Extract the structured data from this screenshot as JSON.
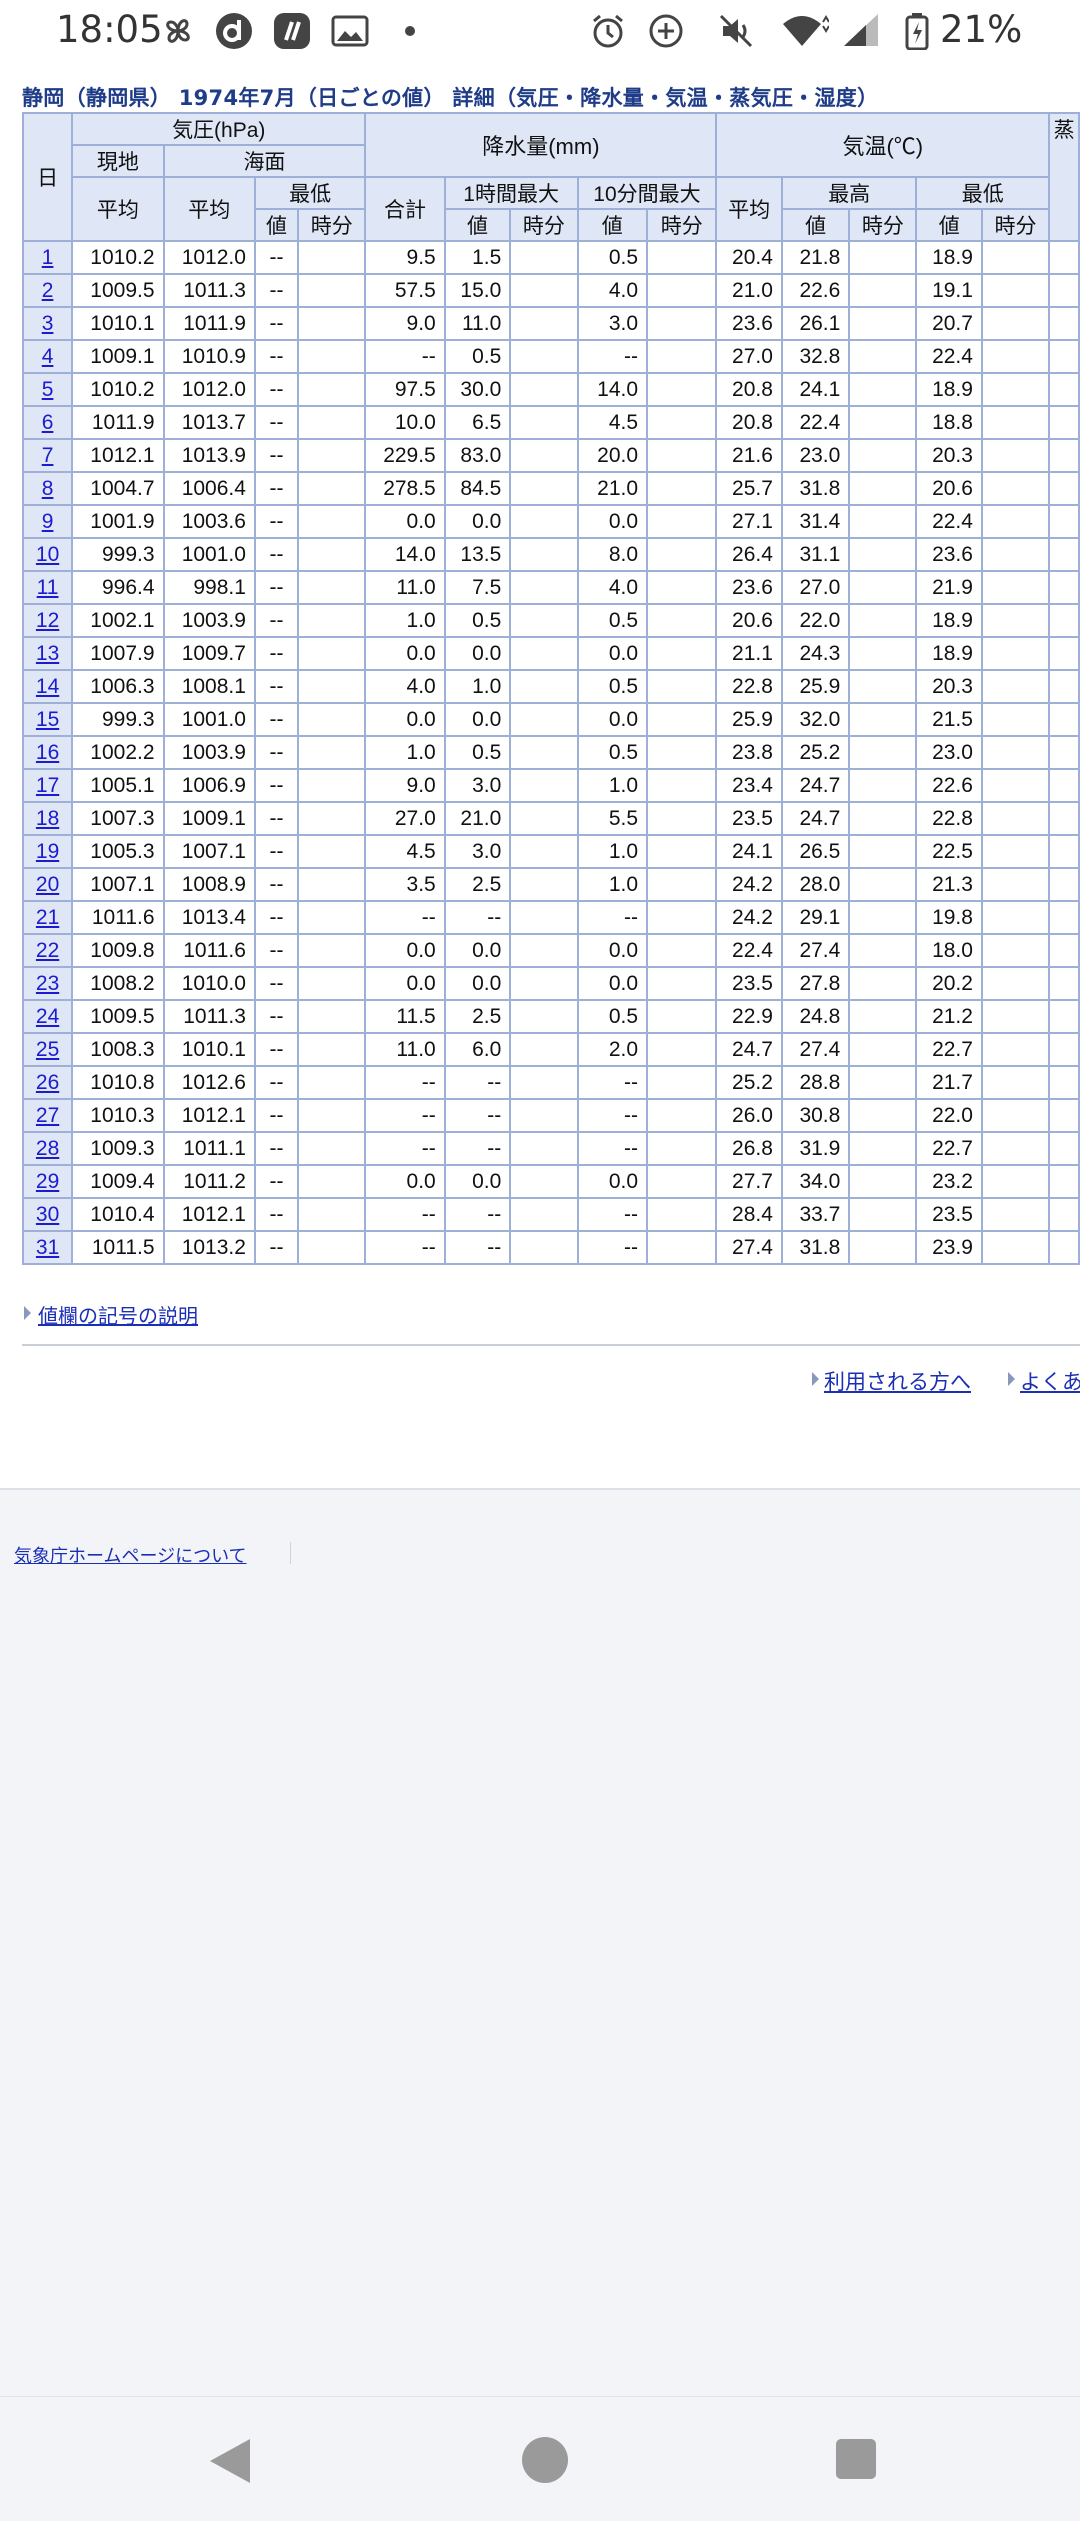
{
  "status_bar": {
    "time": "18:05",
    "battery": "21%",
    "icons": [
      "pinwheel-icon",
      "d-app-icon",
      "slash-app-icon",
      "gallery-icon",
      "dot-icon",
      "alarm-icon",
      "data-saver-icon",
      "mute-icon",
      "wifi-icon",
      "signal-icon",
      "battery-icon"
    ]
  },
  "page": {
    "title": "静岡（静岡県） 1974年7月（日ごとの値） 詳細（気圧・降水量・気温・蒸気圧・湿度）",
    "headers": {
      "day": "日",
      "pressure": "気圧(hPa)",
      "station": "現地",
      "sea": "海面",
      "avg": "平均",
      "min": "最低",
      "value": "値",
      "time": "時分",
      "precip": "降水量(mm)",
      "total": "合計",
      "max1h": "1時間最大",
      "max10m": "10分間最大",
      "temp": "気温(℃)",
      "max": "最高",
      "cut": "蒸"
    },
    "rows": [
      {
        "day": "1",
        "p_avg": "1010.2",
        "s_avg": "1012.0",
        "s_min": "--",
        "s_min_t": "",
        "total": "9.5",
        "h1": "1.5",
        "h1_t": "",
        "m10": "0.5",
        "m10_t": "",
        "t_avg": "20.4",
        "t_max": "21.8",
        "t_max_t": "",
        "t_min": "18.9",
        "t_min_t": ""
      },
      {
        "day": "2",
        "p_avg": "1009.5",
        "s_avg": "1011.3",
        "s_min": "--",
        "s_min_t": "",
        "total": "57.5",
        "h1": "15.0",
        "h1_t": "",
        "m10": "4.0",
        "m10_t": "",
        "t_avg": "21.0",
        "t_max": "22.6",
        "t_max_t": "",
        "t_min": "19.1",
        "t_min_t": ""
      },
      {
        "day": "3",
        "p_avg": "1010.1",
        "s_avg": "1011.9",
        "s_min": "--",
        "s_min_t": "",
        "total": "9.0",
        "h1": "11.0",
        "h1_t": "",
        "m10": "3.0",
        "m10_t": "",
        "t_avg": "23.6",
        "t_max": "26.1",
        "t_max_t": "",
        "t_min": "20.7",
        "t_min_t": ""
      },
      {
        "day": "4",
        "p_avg": "1009.1",
        "s_avg": "1010.9",
        "s_min": "--",
        "s_min_t": "",
        "total": "--",
        "h1": "0.5",
        "h1_t": "",
        "m10": "--",
        "m10_t": "",
        "t_avg": "27.0",
        "t_max": "32.8",
        "t_max_t": "",
        "t_min": "22.4",
        "t_min_t": ""
      },
      {
        "day": "5",
        "p_avg": "1010.2",
        "s_avg": "1012.0",
        "s_min": "--",
        "s_min_t": "",
        "total": "97.5",
        "h1": "30.0",
        "h1_t": "",
        "m10": "14.0",
        "m10_t": "",
        "t_avg": "20.8",
        "t_max": "24.1",
        "t_max_t": "",
        "t_min": "18.9",
        "t_min_t": ""
      },
      {
        "day": "6",
        "p_avg": "1011.9",
        "s_avg": "1013.7",
        "s_min": "--",
        "s_min_t": "",
        "total": "10.0",
        "h1": "6.5",
        "h1_t": "",
        "m10": "4.5",
        "m10_t": "",
        "t_avg": "20.8",
        "t_max": "22.4",
        "t_max_t": "",
        "t_min": "18.8",
        "t_min_t": ""
      },
      {
        "day": "7",
        "p_avg": "1012.1",
        "s_avg": "1013.9",
        "s_min": "--",
        "s_min_t": "",
        "total": "229.5",
        "h1": "83.0",
        "h1_t": "",
        "m10": "20.0",
        "m10_t": "",
        "t_avg": "21.6",
        "t_max": "23.0",
        "t_max_t": "",
        "t_min": "20.3",
        "t_min_t": ""
      },
      {
        "day": "8",
        "p_avg": "1004.7",
        "s_avg": "1006.4",
        "s_min": "--",
        "s_min_t": "",
        "total": "278.5",
        "h1": "84.5",
        "h1_t": "",
        "m10": "21.0",
        "m10_t": "",
        "t_avg": "25.7",
        "t_max": "31.8",
        "t_max_t": "",
        "t_min": "20.6",
        "t_min_t": ""
      },
      {
        "day": "9",
        "p_avg": "1001.9",
        "s_avg": "1003.6",
        "s_min": "--",
        "s_min_t": "",
        "total": "0.0",
        "h1": "0.0",
        "h1_t": "",
        "m10": "0.0",
        "m10_t": "",
        "t_avg": "27.1",
        "t_max": "31.4",
        "t_max_t": "",
        "t_min": "22.4",
        "t_min_t": ""
      },
      {
        "day": "10",
        "p_avg": "999.3",
        "s_avg": "1001.0",
        "s_min": "--",
        "s_min_t": "",
        "total": "14.0",
        "h1": "13.5",
        "h1_t": "",
        "m10": "8.0",
        "m10_t": "",
        "t_avg": "26.4",
        "t_max": "31.1",
        "t_max_t": "",
        "t_min": "23.6",
        "t_min_t": ""
      },
      {
        "day": "11",
        "p_avg": "996.4",
        "s_avg": "998.1",
        "s_min": "--",
        "s_min_t": "",
        "total": "11.0",
        "h1": "7.5",
        "h1_t": "",
        "m10": "4.0",
        "m10_t": "",
        "t_avg": "23.6",
        "t_max": "27.0",
        "t_max_t": "",
        "t_min": "21.9",
        "t_min_t": ""
      },
      {
        "day": "12",
        "p_avg": "1002.1",
        "s_avg": "1003.9",
        "s_min": "--",
        "s_min_t": "",
        "total": "1.0",
        "h1": "0.5",
        "h1_t": "",
        "m10": "0.5",
        "m10_t": "",
        "t_avg": "20.6",
        "t_max": "22.0",
        "t_max_t": "",
        "t_min": "18.9",
        "t_min_t": ""
      },
      {
        "day": "13",
        "p_avg": "1007.9",
        "s_avg": "1009.7",
        "s_min": "--",
        "s_min_t": "",
        "total": "0.0",
        "h1": "0.0",
        "h1_t": "",
        "m10": "0.0",
        "m10_t": "",
        "t_avg": "21.1",
        "t_max": "24.3",
        "t_max_t": "",
        "t_min": "18.9",
        "t_min_t": ""
      },
      {
        "day": "14",
        "p_avg": "1006.3",
        "s_avg": "1008.1",
        "s_min": "--",
        "s_min_t": "",
        "total": "4.0",
        "h1": "1.0",
        "h1_t": "",
        "m10": "0.5",
        "m10_t": "",
        "t_avg": "22.8",
        "t_max": "25.9",
        "t_max_t": "",
        "t_min": "20.3",
        "t_min_t": ""
      },
      {
        "day": "15",
        "p_avg": "999.3",
        "s_avg": "1001.0",
        "s_min": "--",
        "s_min_t": "",
        "total": "0.0",
        "h1": "0.0",
        "h1_t": "",
        "m10": "0.0",
        "m10_t": "",
        "t_avg": "25.9",
        "t_max": "32.0",
        "t_max_t": "",
        "t_min": "21.5",
        "t_min_t": ""
      },
      {
        "day": "16",
        "p_avg": "1002.2",
        "s_avg": "1003.9",
        "s_min": "--",
        "s_min_t": "",
        "total": "1.0",
        "h1": "0.5",
        "h1_t": "",
        "m10": "0.5",
        "m10_t": "",
        "t_avg": "23.8",
        "t_max": "25.2",
        "t_max_t": "",
        "t_min": "23.0",
        "t_min_t": ""
      },
      {
        "day": "17",
        "p_avg": "1005.1",
        "s_avg": "1006.9",
        "s_min": "--",
        "s_min_t": "",
        "total": "9.0",
        "h1": "3.0",
        "h1_t": "",
        "m10": "1.0",
        "m10_t": "",
        "t_avg": "23.4",
        "t_max": "24.7",
        "t_max_t": "",
        "t_min": "22.6",
        "t_min_t": ""
      },
      {
        "day": "18",
        "p_avg": "1007.3",
        "s_avg": "1009.1",
        "s_min": "--",
        "s_min_t": "",
        "total": "27.0",
        "h1": "21.0",
        "h1_t": "",
        "m10": "5.5",
        "m10_t": "",
        "t_avg": "23.5",
        "t_max": "24.7",
        "t_max_t": "",
        "t_min": "22.8",
        "t_min_t": ""
      },
      {
        "day": "19",
        "p_avg": "1005.3",
        "s_avg": "1007.1",
        "s_min": "--",
        "s_min_t": "",
        "total": "4.5",
        "h1": "3.0",
        "h1_t": "",
        "m10": "1.0",
        "m10_t": "",
        "t_avg": "24.1",
        "t_max": "26.5",
        "t_max_t": "",
        "t_min": "22.5",
        "t_min_t": ""
      },
      {
        "day": "20",
        "p_avg": "1007.1",
        "s_avg": "1008.9",
        "s_min": "--",
        "s_min_t": "",
        "total": "3.5",
        "h1": "2.5",
        "h1_t": "",
        "m10": "1.0",
        "m10_t": "",
        "t_avg": "24.2",
        "t_max": "28.0",
        "t_max_t": "",
        "t_min": "21.3",
        "t_min_t": ""
      },
      {
        "day": "21",
        "p_avg": "1011.6",
        "s_avg": "1013.4",
        "s_min": "--",
        "s_min_t": "",
        "total": "--",
        "h1": "--",
        "h1_t": "",
        "m10": "--",
        "m10_t": "",
        "t_avg": "24.2",
        "t_max": "29.1",
        "t_max_t": "",
        "t_min": "19.8",
        "t_min_t": ""
      },
      {
        "day": "22",
        "p_avg": "1009.8",
        "s_avg": "1011.6",
        "s_min": "--",
        "s_min_t": "",
        "total": "0.0",
        "h1": "0.0",
        "h1_t": "",
        "m10": "0.0",
        "m10_t": "",
        "t_avg": "22.4",
        "t_max": "27.4",
        "t_max_t": "",
        "t_min": "18.0",
        "t_min_t": ""
      },
      {
        "day": "23",
        "p_avg": "1008.2",
        "s_avg": "1010.0",
        "s_min": "--",
        "s_min_t": "",
        "total": "0.0",
        "h1": "0.0",
        "h1_t": "",
        "m10": "0.0",
        "m10_t": "",
        "t_avg": "23.5",
        "t_max": "27.8",
        "t_max_t": "",
        "t_min": "20.2",
        "t_min_t": ""
      },
      {
        "day": "24",
        "p_avg": "1009.5",
        "s_avg": "1011.3",
        "s_min": "--",
        "s_min_t": "",
        "total": "11.5",
        "h1": "2.5",
        "h1_t": "",
        "m10": "0.5",
        "m10_t": "",
        "t_avg": "22.9",
        "t_max": "24.8",
        "t_max_t": "",
        "t_min": "21.2",
        "t_min_t": ""
      },
      {
        "day": "25",
        "p_avg": "1008.3",
        "s_avg": "1010.1",
        "s_min": "--",
        "s_min_t": "",
        "total": "11.0",
        "h1": "6.0",
        "h1_t": "",
        "m10": "2.0",
        "m10_t": "",
        "t_avg": "24.7",
        "t_max": "27.4",
        "t_max_t": "",
        "t_min": "22.7",
        "t_min_t": ""
      },
      {
        "day": "26",
        "p_avg": "1010.8",
        "s_avg": "1012.6",
        "s_min": "--",
        "s_min_t": "",
        "total": "--",
        "h1": "--",
        "h1_t": "",
        "m10": "--",
        "m10_t": "",
        "t_avg": "25.2",
        "t_max": "28.8",
        "t_max_t": "",
        "t_min": "21.7",
        "t_min_t": ""
      },
      {
        "day": "27",
        "p_avg": "1010.3",
        "s_avg": "1012.1",
        "s_min": "--",
        "s_min_t": "",
        "total": "--",
        "h1": "--",
        "h1_t": "",
        "m10": "--",
        "m10_t": "",
        "t_avg": "26.0",
        "t_max": "30.8",
        "t_max_t": "",
        "t_min": "22.0",
        "t_min_t": ""
      },
      {
        "day": "28",
        "p_avg": "1009.3",
        "s_avg": "1011.1",
        "s_min": "--",
        "s_min_t": "",
        "total": "--",
        "h1": "--",
        "h1_t": "",
        "m10": "--",
        "m10_t": "",
        "t_avg": "26.8",
        "t_max": "31.9",
        "t_max_t": "",
        "t_min": "22.7",
        "t_min_t": ""
      },
      {
        "day": "29",
        "p_avg": "1009.4",
        "s_avg": "1011.2",
        "s_min": "--",
        "s_min_t": "",
        "total": "0.0",
        "h1": "0.0",
        "h1_t": "",
        "m10": "0.0",
        "m10_t": "",
        "t_avg": "27.7",
        "t_max": "34.0",
        "t_max_t": "",
        "t_min": "23.2",
        "t_min_t": ""
      },
      {
        "day": "30",
        "p_avg": "1010.4",
        "s_avg": "1012.1",
        "s_min": "--",
        "s_min_t": "",
        "total": "--",
        "h1": "--",
        "h1_t": "",
        "m10": "--",
        "m10_t": "",
        "t_avg": "28.4",
        "t_max": "33.7",
        "t_max_t": "",
        "t_min": "23.5",
        "t_min_t": ""
      },
      {
        "day": "31",
        "p_avg": "1011.5",
        "s_avg": "1013.2",
        "s_min": "--",
        "s_min_t": "",
        "total": "--",
        "h1": "--",
        "h1_t": "",
        "m10": "--",
        "m10_t": "",
        "t_avg": "27.4",
        "t_max": "31.8",
        "t_max_t": "",
        "t_min": "23.9",
        "t_min_t": ""
      }
    ],
    "note_link": "値欄の記号の説明",
    "links": [
      "利用される方へ",
      "よくある"
    ],
    "footer_link": "気象庁ホームページについて"
  },
  "colors": {
    "header_bg": "#dfe6f5",
    "border": "#9fb0d8",
    "title": "#1f3c88",
    "link": "#1b2fb5"
  }
}
